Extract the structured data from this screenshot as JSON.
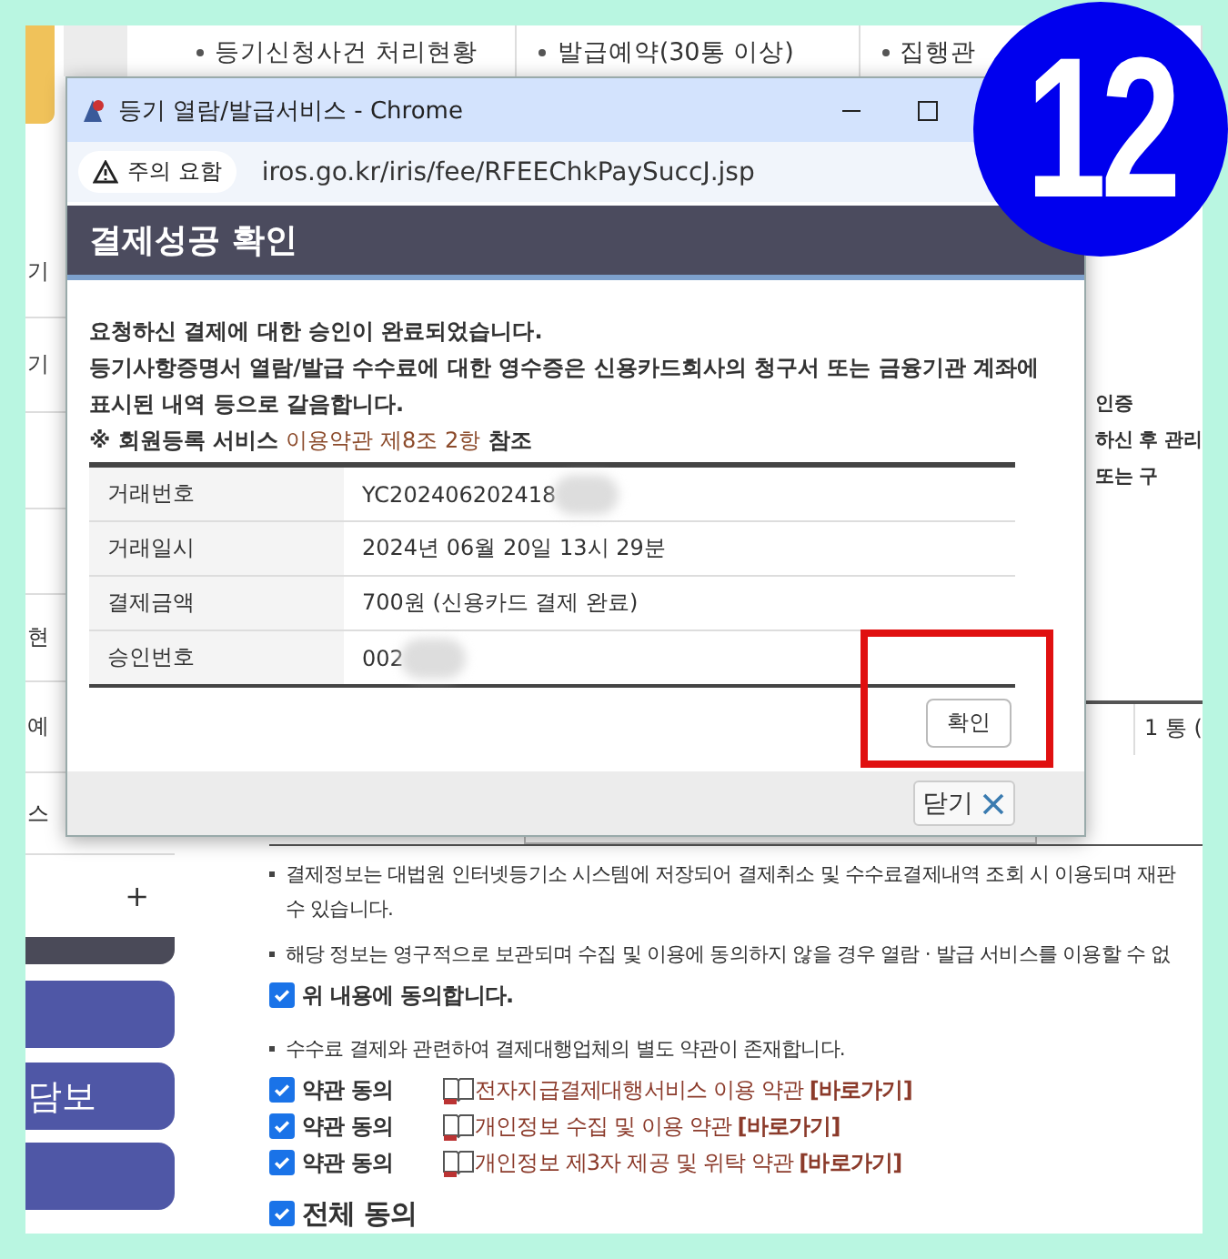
{
  "nav_tabs": [
    "등기신청사건 처리현황",
    "발급예약(30통 이상)",
    "집행관"
  ],
  "sidebar": {
    "fragments": [
      "기",
      "기",
      "현",
      "예",
      "스"
    ],
    "expand_symbol": "+",
    "menu_buttons": [
      {
        "kind": "blank"
      },
      {
        "kind": "labeled",
        "label": "담보"
      },
      {
        "kind": "blank"
      }
    ]
  },
  "page_fragments": [
    "인증",
    "하신 후 관리",
    "또는 구"
  ],
  "count_cell": "1 통 (",
  "notices": [
    {
      "lines": [
        "결제정보는 대법원 인터넷등기소 시스템에 저장되어 결제취소 및 수수료결제내역 조회 시 이용되며 재판",
        "수 있습니다."
      ]
    },
    {
      "lines": [
        "해당 정보는 영구적으로 보관되며 수집 및 이용에 동의하지 않을 경우 열람 · 발급 서비스를 이용할 수 없"
      ]
    }
  ],
  "agree": {
    "label": "위 내용에 동의합니다.",
    "checked": true
  },
  "terms_notice": "수수료 결제와 관련하여 결제대행업체의 별도 약관이 존재합니다.",
  "terms": [
    {
      "label": "약관 동의",
      "checked": true,
      "link_text": "전자지급결제대행서비스 이용 약관",
      "link_action": "[바로가기]"
    },
    {
      "label": "약관 동의",
      "checked": true,
      "link_text": "개인정보 수집 및 이용 약관",
      "link_action": "[바로가기]"
    },
    {
      "label": "약관 동의",
      "checked": true,
      "link_text": "개인정보 제3자 제공 및 위탁 약관",
      "link_action": "[바로가기]"
    }
  ],
  "all_agree": {
    "label": "전체 동의",
    "checked": true
  },
  "popup": {
    "window_title": "등기 열람/발급서비스 - Chrome",
    "security_label": "주의 요함",
    "url": "iros.go.kr/iris/fee/RFEEChkPaySuccJ.jsp",
    "header": "결제성공 확인",
    "messages": [
      "요청하신 결제에 대한 승인이 완료되었습니다.",
      "등기사항증명서 열람/발급 수수료에 대한 영수증은 신용카드회사의 청구서 또는 금융기관 계좌에 표시된 내역 등으로 갈음합니다."
    ],
    "note_prefix": "※ 회원등록 서비스",
    "note_link": "이용약관 제8조 2항",
    "note_suffix": "참조",
    "table": [
      {
        "label": "거래번호",
        "value": "YC202406202418",
        "redacted": true
      },
      {
        "label": "거래일시",
        "value": "2024년 06월 20일 13시 29분",
        "redacted": false
      },
      {
        "label": "결제금액",
        "value": "700원 (신용카드 결제 완료)",
        "redacted": false
      },
      {
        "label": "승인번호",
        "value": "002",
        "redacted": true
      }
    ],
    "confirm": {
      "label": "확인",
      "highlighted": true
    },
    "close_button": "닫기"
  },
  "badge": {
    "number": "12"
  }
}
